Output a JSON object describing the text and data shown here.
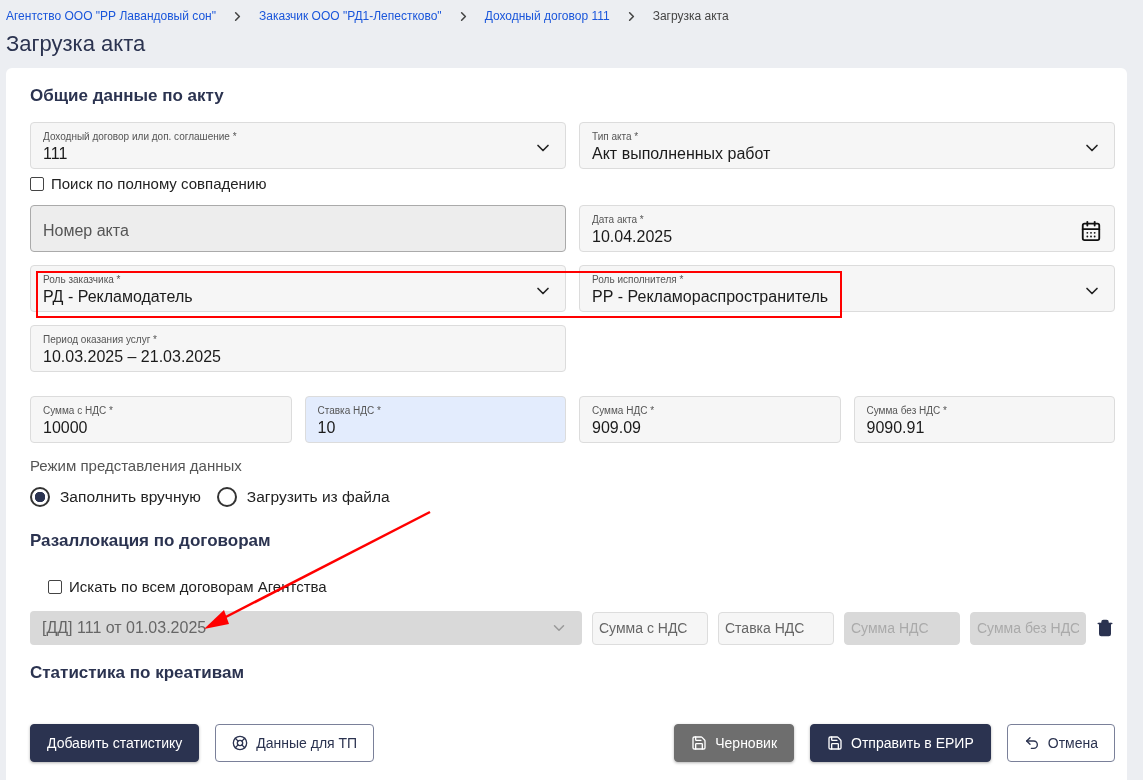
{
  "breadcrumbs": [
    {
      "label": "Агентство ООО \"РР Лавандовый сон\"",
      "kind": "link"
    },
    {
      "label": "Заказчик ООО \"РД1-Лепестково\"",
      "kind": "link"
    },
    {
      "label": "Доходный договор 111",
      "kind": "link"
    },
    {
      "label": "Загрузка акта",
      "kind": "current"
    }
  ],
  "title": "Загрузка акта",
  "general": {
    "title": "Общие данные по акту",
    "contract": {
      "label": "Доходный договор или доп. соглашение *",
      "value": "111"
    },
    "exact_search": {
      "label": "Поиск по полному совпадению",
      "checked": false
    },
    "act_type": {
      "label": "Тип акта *",
      "value": "Акт выполненных работ"
    },
    "act_number": {
      "placeholder": "Номер акта"
    },
    "act_date": {
      "label": "Дата акта *",
      "value": "10.04.2025"
    },
    "customer_role": {
      "label": "Роль заказчика *",
      "value": "РД - Рекламодатель"
    },
    "executor_role": {
      "label": "Роль исполнителя *",
      "value": "РР - Рекламораспространитель"
    },
    "period": {
      "label": "Период оказания услуг *",
      "value": "10.03.2025 – 21.03.2025"
    },
    "amounts": [
      {
        "label": "Сумма с НДС *",
        "value": "10000",
        "focused": false
      },
      {
        "label": "Ставка НДС *",
        "value": "10",
        "focused": true
      },
      {
        "label": "Сумма НДС *",
        "value": "909.09",
        "focused": false
      },
      {
        "label": "Сумма без НДС *",
        "value": "9090.91",
        "focused": false
      }
    ],
    "mode": {
      "label": "Режим представления данных",
      "options": [
        {
          "label": "Заполнить вручную",
          "selected": true
        },
        {
          "label": "Загрузить из файла",
          "selected": false
        }
      ]
    }
  },
  "reallocation": {
    "title": "Разаллокация по договорам",
    "search_all": {
      "label": "Искать по всем договорам Агентства",
      "checked": false
    },
    "contract": {
      "value": "[ДД] 111 от 01.03.2025",
      "disabled": true
    },
    "inputs": [
      {
        "placeholder": "Сумма с НДС",
        "disabled": false
      },
      {
        "placeholder": "Ставка НДС",
        "disabled": false
      },
      {
        "placeholder": "Сумма НДС",
        "disabled": true
      },
      {
        "placeholder": "Сумма без НДС",
        "disabled": true
      }
    ]
  },
  "statistics": {
    "title": "Статистика по креативам"
  },
  "left_buttons": [
    {
      "label": "Добавить статистику",
      "kind": "primary"
    },
    {
      "label": "Данные для ТП",
      "kind": "outline"
    }
  ],
  "right_buttons": [
    {
      "label": "Черновик",
      "kind": "secondary"
    },
    {
      "label": "Отправить в ЕРИР",
      "kind": "primary"
    },
    {
      "label": "Отмена",
      "kind": "outline"
    }
  ]
}
